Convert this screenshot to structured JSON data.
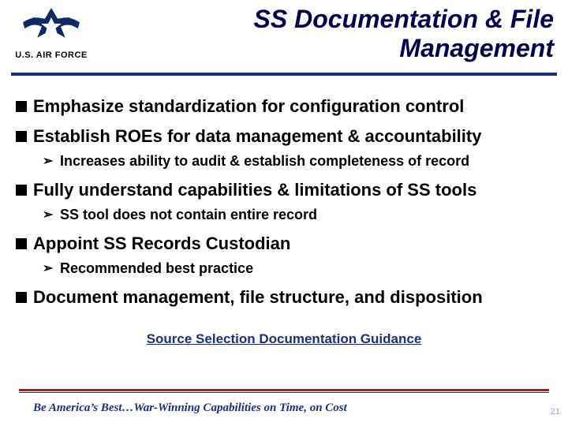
{
  "header": {
    "logo_label": "U.S. AIR FORCE",
    "title_line1": "SS Documentation & File",
    "title_line2": "Management"
  },
  "bullets": {
    "b1": "Emphasize standardization for configuration control",
    "b2": "Establish ROEs for data management & accountability",
    "b2_sub1": "Increases ability to audit & establish completeness of record",
    "b3": "Fully understand capabilities & limitations of SS tools",
    "b3_sub1": "SS tool does not contain entire record",
    "b4": "Appoint SS Records Custodian",
    "b4_sub1": "Recommended best practice",
    "b5": "Document management, file structure, and disposition"
  },
  "link": {
    "text": "Source Selection Documentation Guidance"
  },
  "footer": {
    "tagline": "Be America’s Best…War-Winning Capabilities on Time, on Cost",
    "page_number": "21"
  }
}
